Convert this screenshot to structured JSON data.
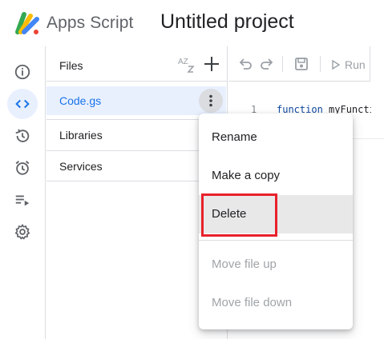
{
  "header": {
    "app_name": "Apps Script",
    "project_name": "Untitled project"
  },
  "rail": {
    "items": [
      {
        "icon": "info-icon",
        "label": "Overview"
      },
      {
        "icon": "code-icon",
        "label": "Editor",
        "active": true
      },
      {
        "icon": "history-icon",
        "label": "Executions"
      },
      {
        "icon": "alarm-icon",
        "label": "Triggers"
      },
      {
        "icon": "playlist-icon",
        "label": "Executions list"
      },
      {
        "icon": "gear-icon",
        "label": "Project Settings"
      }
    ]
  },
  "files": {
    "title": "Files",
    "sort_label": "AZ",
    "items": [
      {
        "name": "Code.gs",
        "selected": true
      }
    ],
    "sections": {
      "libraries": "Libraries",
      "services": "Services"
    }
  },
  "toolbar": {
    "run_label": "Run"
  },
  "editor": {
    "line_number": "1",
    "keyword": "function",
    "code_rest": "myFunction() {"
  },
  "context_menu": {
    "rename": "Rename",
    "make_copy": "Make a copy",
    "delete": "Delete",
    "move_up": "Move file up",
    "move_down": "Move file down"
  },
  "colors": {
    "accent": "#1a73e8",
    "selected_bg": "#e8f0fe",
    "highlight_border": "#e8202a",
    "disabled_text": "#a0a4a8"
  }
}
